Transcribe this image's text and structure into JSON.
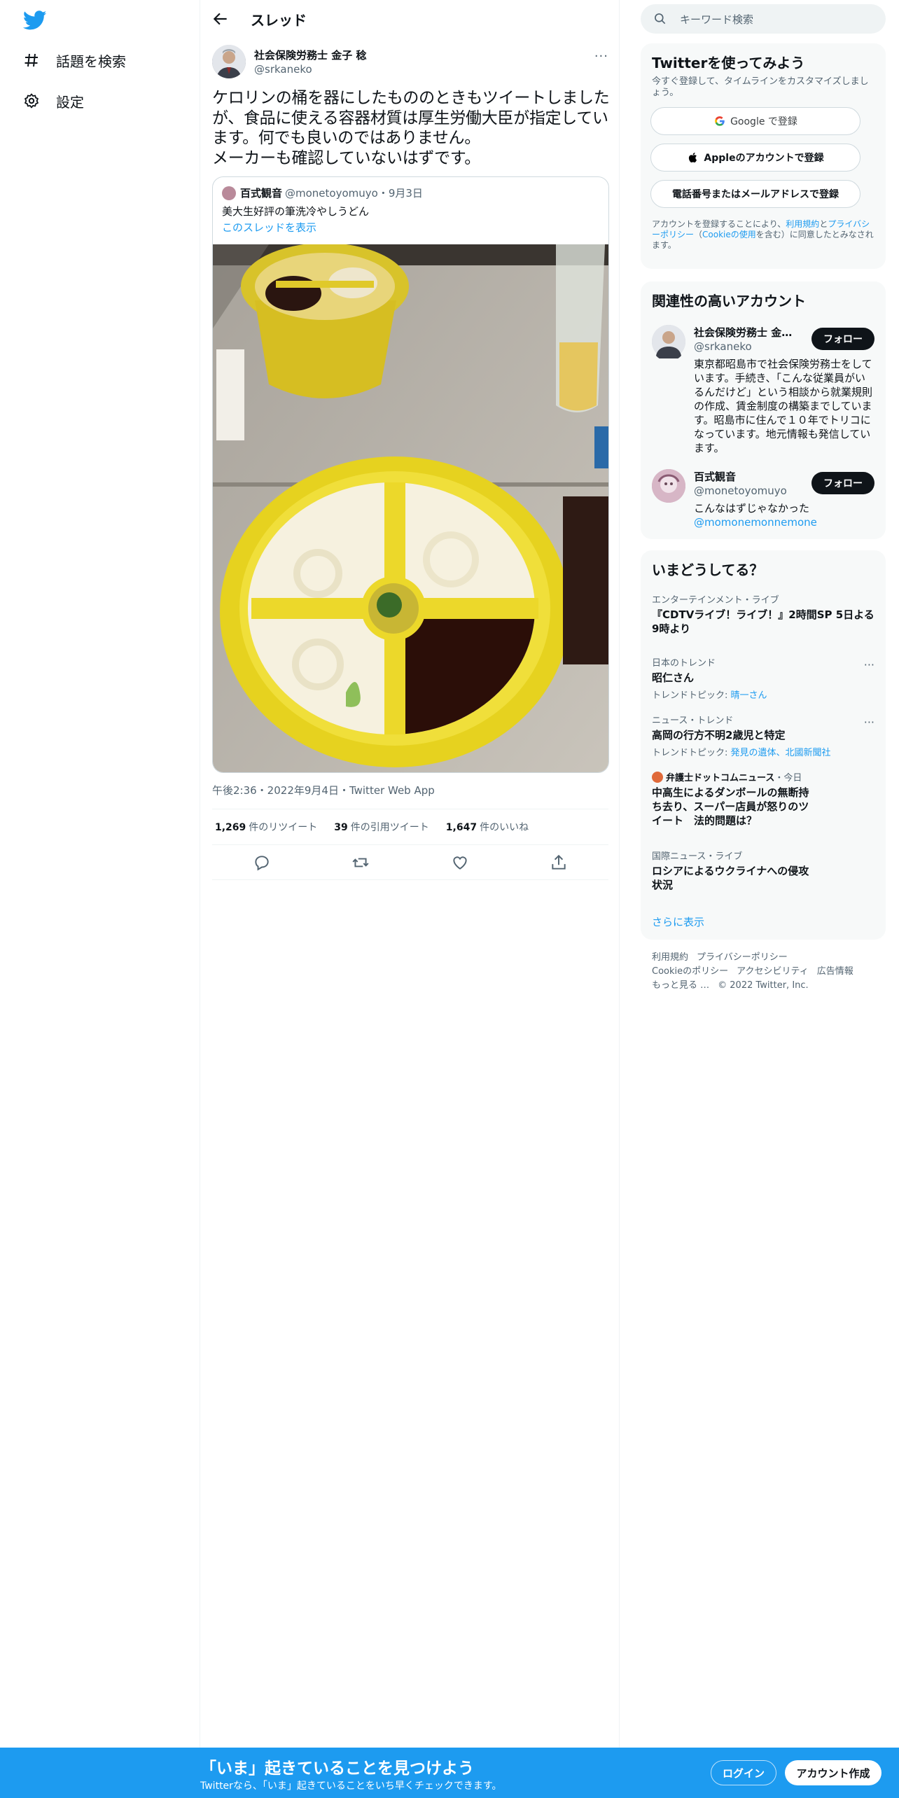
{
  "nav": {
    "explore": "話題を検索",
    "settings": "設定"
  },
  "header": {
    "title": "スレッド"
  },
  "tweet": {
    "author_name": "社会保険労務士 金子 稔",
    "author_handle": "@srkaneko",
    "more": "···",
    "text": "ケロリンの桶を器にしたもののときもツイートしましたが、食品に使える容器材質は厚生労働大臣が指定しています。何でも良いのではありません。\nメーカーも確認していないはずです。",
    "timestamp": "午後2:36・2022年9月4日・Twitter Web App",
    "retweets_count": "1,269",
    "retweets_label": "件のリツイート",
    "quotes_count": "39",
    "quotes_label": "件の引用ツイート",
    "likes_count": "1,647",
    "likes_label": "件のいいね"
  },
  "quoted": {
    "name": "百式観音",
    "handle": "@monetoyomuyo",
    "date": "・9月3日",
    "text": "美大生好評の筆洗冷やしうどん",
    "link": "このスレッドを表示"
  },
  "right": {
    "search_placeholder": "キーワード検索",
    "signup": {
      "title": "Twitterを使ってみよう",
      "desc": "今すぐ登録して、タイムラインをカスタマイズしましょう。",
      "google": "Google で登録",
      "apple": "Appleのアカウントで登録",
      "phone": "電話番号またはメールアドレスで登録",
      "legal_pre": "アカウントを登録することにより、",
      "terms": "利用規約",
      "and": "と",
      "privacy": "プライバシーポリシー",
      "cookie_pre": "（",
      "cookie": "Cookieの使用",
      "legal_post": "を含む）に同意したとみなされます。"
    },
    "related": {
      "title": "関連性の高いアカウント",
      "accounts": [
        {
          "name": "社会保険労務士 金子…",
          "handle": "@srkaneko",
          "follow": "フォロー",
          "bio": "東京都昭島市で社会保険労務士をしています。手続き、「こんな従業員がいるんだけど」という相談から就業規則の作成、賃金制度の構築までしています。昭島市に住んで１０年でトリコになっています。地元情報も発信しています。"
        },
        {
          "name": "百式観音",
          "handle": "@monetoyomuyo",
          "follow": "フォロー",
          "bio": "こんなはずじゃなかった",
          "bio_link": "@momonemonnemone"
        }
      ]
    },
    "trends": {
      "title": "いまどうしてる？",
      "items": [
        {
          "meta": "エンターテインメント・ライブ",
          "name": "『CDTVライブ！ライブ！』2時間SP 5日よる9時より"
        },
        {
          "meta": "日本のトレンド",
          "name": "昭仁さん",
          "topic_label": "トレンドトピック: ",
          "topic": "晴一さん"
        },
        {
          "meta": "ニュース・トレンド",
          "name": "高岡の行方不明2歳児と特定",
          "topic_label": "トレンドトピック: ",
          "topic": "発見の遺体、北國新聞社"
        },
        {
          "meta_source": "弁護士ドットコムニュース",
          "meta_time": "・今日",
          "name": "中高生によるダンボールの無断持ち去り、スーパー店員が怒りのツイート　法的問題は？"
        },
        {
          "meta": "国際ニュース・ライブ",
          "name": "ロシアによるウクライナへの侵攻状況"
        }
      ],
      "show_more": "さらに表示"
    },
    "footer": {
      "terms": "利用規約",
      "privacy": "プライバシーポリシー",
      "cookie": "Cookieのポリシー",
      "accessibility": "アクセシビリティ",
      "ads": "広告情報",
      "more": "もっと見る …",
      "copyright": "© 2022 Twitter, Inc."
    }
  },
  "banner": {
    "title": "「いま」起きていることを見つけよう",
    "sub": "Twitterなら、「いま」起きていることをいち早くチェックできます。",
    "login": "ログイン",
    "signup": "アカウント作成"
  },
  "colors": {
    "accent": "#1d9bf0",
    "text": "#0f1419",
    "muted": "#536471"
  }
}
